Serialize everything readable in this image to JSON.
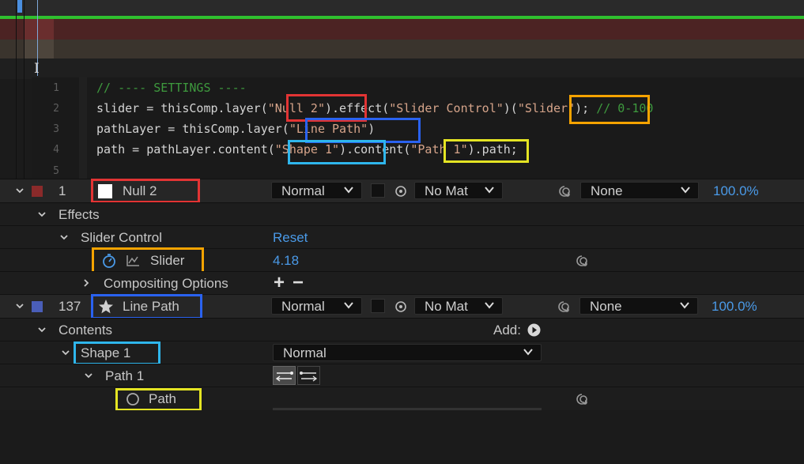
{
  "editor": {
    "line_numbers": [
      "1",
      "2",
      "3",
      "4",
      "5"
    ],
    "lines": [
      [
        {
          "t": "// ---- SETTINGS ----",
          "c": "c-com"
        }
      ],
      [
        {
          "t": "slider = thisComp.layer("
        },
        {
          "t": "\"Null 2\"",
          "c": "c-str"
        },
        {
          "t": ").effect("
        },
        {
          "t": "\"Slider Control\"",
          "c": "c-str"
        },
        {
          "t": ")("
        },
        {
          "t": "\"Slider\"",
          "c": "c-str"
        },
        {
          "t": "); "
        },
        {
          "t": "// 0-100",
          "c": "c-com"
        }
      ],
      [
        {
          "t": "pathLayer = thisComp.layer("
        },
        {
          "t": "\"Line Path\"",
          "c": "c-str"
        },
        {
          "t": ")"
        }
      ],
      [
        {
          "t": "path = pathLayer.content("
        },
        {
          "t": "\"Shape 1\"",
          "c": "c-str"
        },
        {
          "t": ").content("
        },
        {
          "t": "\"Path 1\"",
          "c": "c-str"
        },
        {
          "t": ").path;"
        }
      ],
      []
    ]
  },
  "layer_null": {
    "color": "#8a2a2a",
    "index": "1",
    "name": "Null 2",
    "mode": "Normal",
    "matte": "No Mat",
    "parent": "None",
    "opacity": "100.0%"
  },
  "effects_label": "Effects",
  "slider_control": {
    "label": "Slider Control",
    "reset": "Reset"
  },
  "slider_prop": {
    "label": "Slider",
    "value": "4.18"
  },
  "compositing_options": {
    "label": "Compositing Options",
    "plus": "+",
    "minus": "−"
  },
  "layer_line": {
    "color": "#4a5eb8",
    "index": "137",
    "name": "Line Path",
    "mode": "Normal",
    "matte": "No Mat",
    "parent": "None",
    "opacity": "100.0%"
  },
  "contents": {
    "label": "Contents",
    "add_label": "Add:"
  },
  "shape1": {
    "label": "Shape 1",
    "blend": "Normal"
  },
  "path1": {
    "label": "Path 1"
  },
  "path_prop": {
    "label": "Path"
  },
  "accent_colors": {
    "red": "#e23434",
    "orange": "#f5a300",
    "blue": "#2a62f0",
    "cyan": "#2fb6ec",
    "yellow": "#e4e423"
  }
}
